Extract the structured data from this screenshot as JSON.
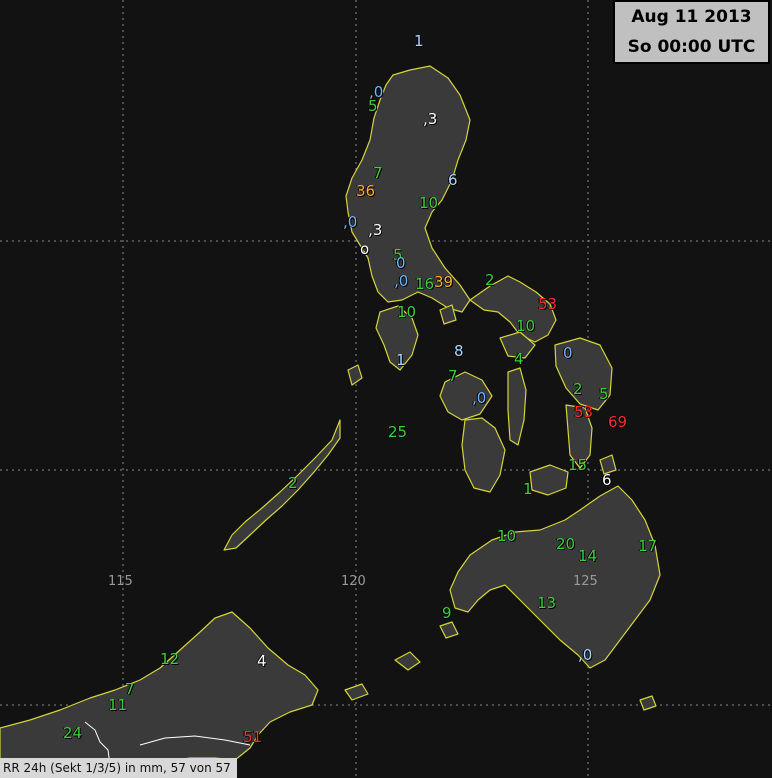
{
  "header": {
    "date": "Aug 11 2013",
    "time": "So 00:00 UTC"
  },
  "footer": "RR 24h (Sekt 1/3/5) in mm, 57 von 57",
  "lon_labels": [
    "115",
    "120",
    "125"
  ],
  "colors": {
    "white": "#ffffff",
    "light_blue": "#a6d8ff",
    "blue": "#6fb5ff",
    "green": "#3ccf3c",
    "orange": "#ffb020",
    "red": "#ff2a2a",
    "coast": "#d4d43a",
    "land": "#3a3a3a",
    "sea": "#121212"
  },
  "stations": [
    {
      "text": "1",
      "color": "light_blue"
    },
    {
      "text": ",0",
      "color": "blue"
    },
    {
      "text": "5",
      "color": "green"
    },
    {
      "text": ",3",
      "color": "white"
    },
    {
      "text": "7",
      "color": "green"
    },
    {
      "text": "36",
      "color": "orange"
    },
    {
      "text": "6",
      "color": "light_blue"
    },
    {
      "text": "10",
      "color": "green"
    },
    {
      "text": ",0",
      "color": "blue"
    },
    {
      "text": ",3",
      "color": "white"
    },
    {
      "text": "o",
      "color": "white"
    },
    {
      "text": "5",
      "color": "green"
    },
    {
      "text": "0",
      "color": "blue"
    },
    {
      "text": ",0",
      "color": "blue"
    },
    {
      "text": "16",
      "color": "green"
    },
    {
      "text": "39",
      "color": "orange"
    },
    {
      "text": "2",
      "color": "green"
    },
    {
      "text": "53",
      "color": "red"
    },
    {
      "text": "10",
      "color": "green"
    },
    {
      "text": "10",
      "color": "green"
    },
    {
      "text": "1",
      "color": "light_blue"
    },
    {
      "text": "8",
      "color": "light_blue"
    },
    {
      "text": "0",
      "color": "blue"
    },
    {
      "text": "4",
      "color": "green"
    },
    {
      "text": "7",
      "color": "green"
    },
    {
      "text": "2",
      "color": "green"
    },
    {
      "text": "5",
      "color": "green"
    },
    {
      "text": ",0",
      "color": "blue"
    },
    {
      "text": "53",
      "color": "red"
    },
    {
      "text": "69",
      "color": "red"
    },
    {
      "text": "25",
      "color": "green"
    },
    {
      "text": "15",
      "color": "green"
    },
    {
      "text": "6",
      "color": "white"
    },
    {
      "text": "2",
      "color": "green"
    },
    {
      "text": "1",
      "color": "green"
    },
    {
      "text": "10",
      "color": "green"
    },
    {
      "text": "20",
      "color": "green"
    },
    {
      "text": "14",
      "color": "green"
    },
    {
      "text": "17",
      "color": "green"
    },
    {
      "text": "13",
      "color": "green"
    },
    {
      "text": "9",
      "color": "green"
    },
    {
      "text": ",0",
      "color": "light_blue"
    },
    {
      "text": "12",
      "color": "green"
    },
    {
      "text": "4",
      "color": "white"
    },
    {
      "text": "7",
      "color": "green"
    },
    {
      "text": "11",
      "color": "green"
    },
    {
      "text": "24",
      "color": "green"
    },
    {
      "text": "51",
      "color": "red"
    }
  ]
}
